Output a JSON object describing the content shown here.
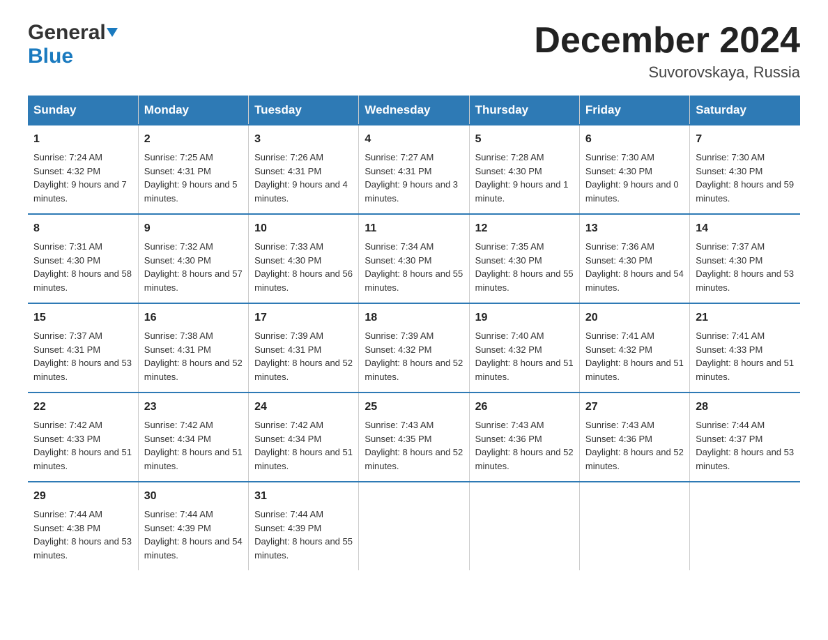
{
  "header": {
    "title": "December 2024",
    "subtitle": "Suvorovskaya, Russia"
  },
  "logo": {
    "general": "General",
    "blue": "Blue"
  },
  "days": [
    "Sunday",
    "Monday",
    "Tuesday",
    "Wednesday",
    "Thursday",
    "Friday",
    "Saturday"
  ],
  "weeks": [
    [
      {
        "num": "1",
        "sunrise": "7:24 AM",
        "sunset": "4:32 PM",
        "daylight": "9 hours and 7 minutes."
      },
      {
        "num": "2",
        "sunrise": "7:25 AM",
        "sunset": "4:31 PM",
        "daylight": "9 hours and 5 minutes."
      },
      {
        "num": "3",
        "sunrise": "7:26 AM",
        "sunset": "4:31 PM",
        "daylight": "9 hours and 4 minutes."
      },
      {
        "num": "4",
        "sunrise": "7:27 AM",
        "sunset": "4:31 PM",
        "daylight": "9 hours and 3 minutes."
      },
      {
        "num": "5",
        "sunrise": "7:28 AM",
        "sunset": "4:30 PM",
        "daylight": "9 hours and 1 minute."
      },
      {
        "num": "6",
        "sunrise": "7:30 AM",
        "sunset": "4:30 PM",
        "daylight": "9 hours and 0 minutes."
      },
      {
        "num": "7",
        "sunrise": "7:30 AM",
        "sunset": "4:30 PM",
        "daylight": "8 hours and 59 minutes."
      }
    ],
    [
      {
        "num": "8",
        "sunrise": "7:31 AM",
        "sunset": "4:30 PM",
        "daylight": "8 hours and 58 minutes."
      },
      {
        "num": "9",
        "sunrise": "7:32 AM",
        "sunset": "4:30 PM",
        "daylight": "8 hours and 57 minutes."
      },
      {
        "num": "10",
        "sunrise": "7:33 AM",
        "sunset": "4:30 PM",
        "daylight": "8 hours and 56 minutes."
      },
      {
        "num": "11",
        "sunrise": "7:34 AM",
        "sunset": "4:30 PM",
        "daylight": "8 hours and 55 minutes."
      },
      {
        "num": "12",
        "sunrise": "7:35 AM",
        "sunset": "4:30 PM",
        "daylight": "8 hours and 55 minutes."
      },
      {
        "num": "13",
        "sunrise": "7:36 AM",
        "sunset": "4:30 PM",
        "daylight": "8 hours and 54 minutes."
      },
      {
        "num": "14",
        "sunrise": "7:37 AM",
        "sunset": "4:30 PM",
        "daylight": "8 hours and 53 minutes."
      }
    ],
    [
      {
        "num": "15",
        "sunrise": "7:37 AM",
        "sunset": "4:31 PM",
        "daylight": "8 hours and 53 minutes."
      },
      {
        "num": "16",
        "sunrise": "7:38 AM",
        "sunset": "4:31 PM",
        "daylight": "8 hours and 52 minutes."
      },
      {
        "num": "17",
        "sunrise": "7:39 AM",
        "sunset": "4:31 PM",
        "daylight": "8 hours and 52 minutes."
      },
      {
        "num": "18",
        "sunrise": "7:39 AM",
        "sunset": "4:32 PM",
        "daylight": "8 hours and 52 minutes."
      },
      {
        "num": "19",
        "sunrise": "7:40 AM",
        "sunset": "4:32 PM",
        "daylight": "8 hours and 51 minutes."
      },
      {
        "num": "20",
        "sunrise": "7:41 AM",
        "sunset": "4:32 PM",
        "daylight": "8 hours and 51 minutes."
      },
      {
        "num": "21",
        "sunrise": "7:41 AM",
        "sunset": "4:33 PM",
        "daylight": "8 hours and 51 minutes."
      }
    ],
    [
      {
        "num": "22",
        "sunrise": "7:42 AM",
        "sunset": "4:33 PM",
        "daylight": "8 hours and 51 minutes."
      },
      {
        "num": "23",
        "sunrise": "7:42 AM",
        "sunset": "4:34 PM",
        "daylight": "8 hours and 51 minutes."
      },
      {
        "num": "24",
        "sunrise": "7:42 AM",
        "sunset": "4:34 PM",
        "daylight": "8 hours and 51 minutes."
      },
      {
        "num": "25",
        "sunrise": "7:43 AM",
        "sunset": "4:35 PM",
        "daylight": "8 hours and 52 minutes."
      },
      {
        "num": "26",
        "sunrise": "7:43 AM",
        "sunset": "4:36 PM",
        "daylight": "8 hours and 52 minutes."
      },
      {
        "num": "27",
        "sunrise": "7:43 AM",
        "sunset": "4:36 PM",
        "daylight": "8 hours and 52 minutes."
      },
      {
        "num": "28",
        "sunrise": "7:44 AM",
        "sunset": "4:37 PM",
        "daylight": "8 hours and 53 minutes."
      }
    ],
    [
      {
        "num": "29",
        "sunrise": "7:44 AM",
        "sunset": "4:38 PM",
        "daylight": "8 hours and 53 minutes."
      },
      {
        "num": "30",
        "sunrise": "7:44 AM",
        "sunset": "4:39 PM",
        "daylight": "8 hours and 54 minutes."
      },
      {
        "num": "31",
        "sunrise": "7:44 AM",
        "sunset": "4:39 PM",
        "daylight": "8 hours and 55 minutes."
      },
      null,
      null,
      null,
      null
    ]
  ],
  "labels": {
    "sunrise": "Sunrise:",
    "sunset": "Sunset:",
    "daylight": "Daylight:"
  }
}
